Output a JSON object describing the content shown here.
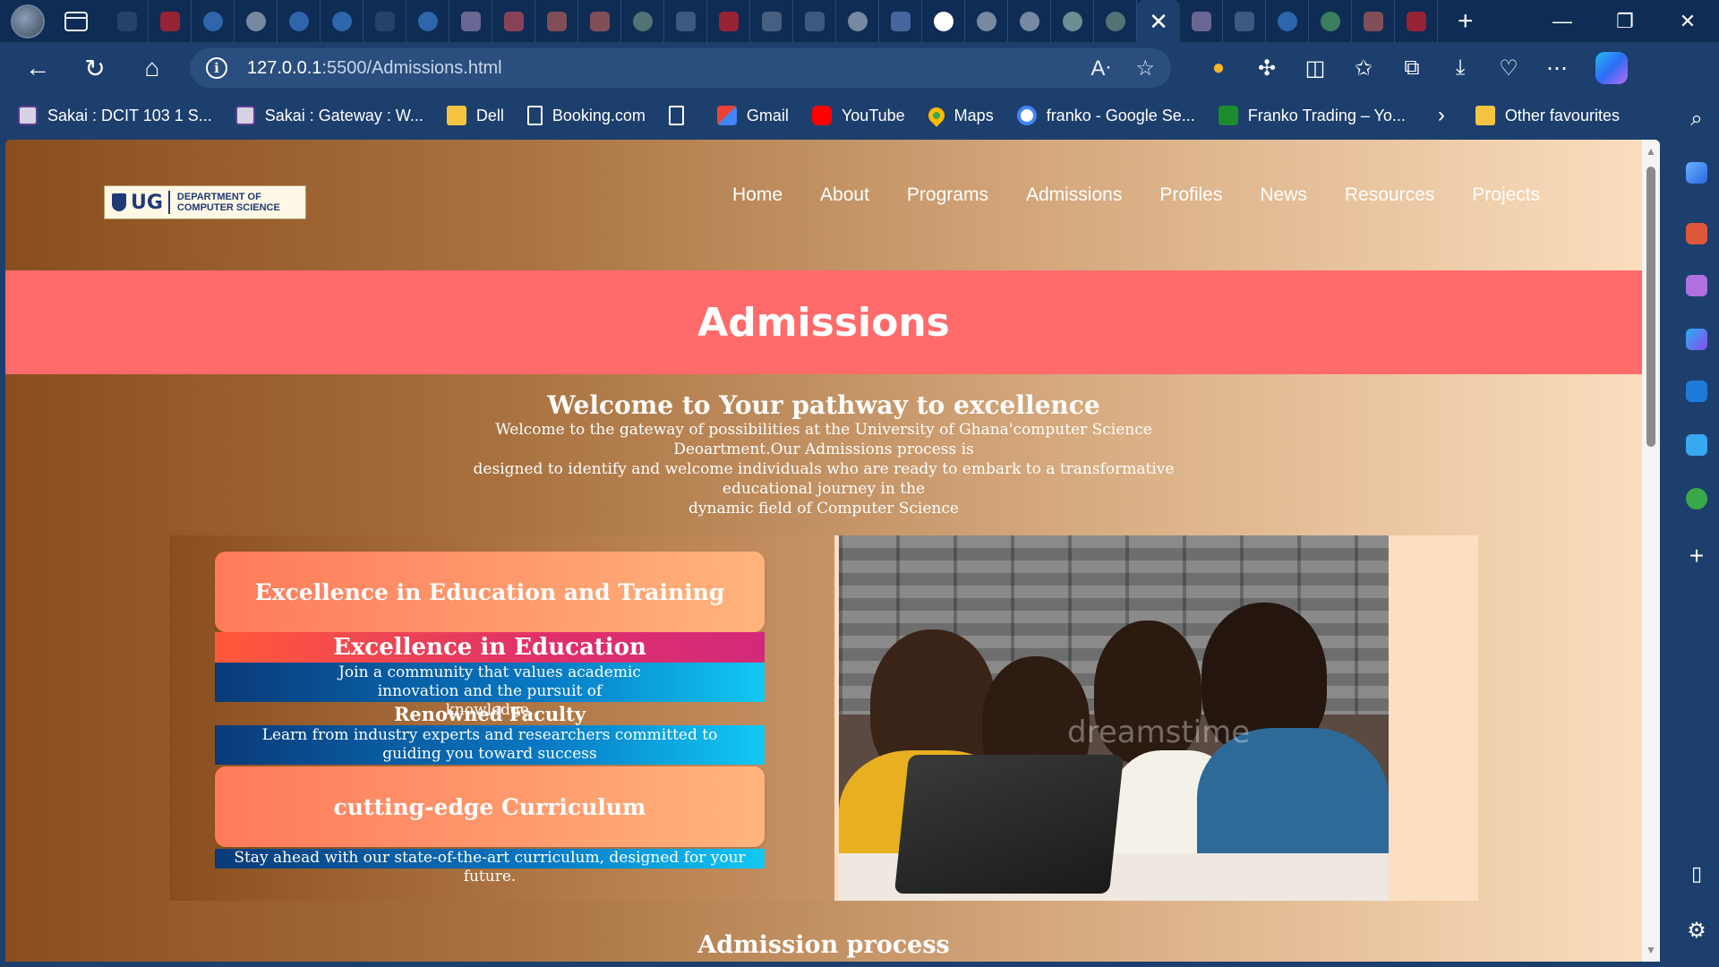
{
  "browser": {
    "address": {
      "host": "127.0.0.1",
      "rest": ":5500/Admissions.html"
    },
    "window_controls": {
      "minimize": "—",
      "maximize": "❐",
      "close": "✕"
    },
    "tab_close": "✕",
    "new_tab": "+",
    "favourites": [
      {
        "label": "Sakai : DCIT 103 1 S...",
        "icon": "sakai"
      },
      {
        "label": "Sakai : Gateway : W...",
        "icon": "sakai"
      },
      {
        "label": "Dell",
        "icon": "folder"
      },
      {
        "label": "Booking.com",
        "icon": "page"
      },
      {
        "label": "",
        "icon": "page"
      },
      {
        "label": "Gmail",
        "icon": "gmail"
      },
      {
        "label": "YouTube",
        "icon": "yt"
      },
      {
        "label": "Maps",
        "icon": "maps"
      },
      {
        "label": "franko - Google Se...",
        "icon": "google"
      },
      {
        "label": "Franko Trading – Yo...",
        "icon": "franko"
      }
    ],
    "favourites_more": "›",
    "other_favourites": "Other favourites"
  },
  "site": {
    "logo": {
      "mark": "UG",
      "text_line1": "DEPARTMENT OF",
      "text_line2": "COMPUTER SCIENCE"
    },
    "menu": [
      "Home",
      "About",
      "Programs",
      "Admissions",
      "Profiles",
      "News",
      "Resources",
      "Projects"
    ],
    "banner_title": "Admissions",
    "welcome_title": "Welcome to Your pathway to excellence",
    "welcome_lines": [
      "Welcome to the gateway of possibilities at the University of Ghana'computer Science Deoartment.Our Admissions process is",
      "designed to identify and welcome individuals who are ready to embark to a transformative educational journey in the",
      "dynamic field of Computer Science"
    ],
    "cards": {
      "card1": "Excellence in Education and Training",
      "stripe_title": "Excellence in Education",
      "stripe_text": "Join a community that values academic innovation and the pursuit of knowledge.",
      "faculty_title": "Renowned Faculty",
      "faculty_text": "Learn from industry experts and researchers committed to guiding you toward success",
      "card2": "cutting-edge Curriculum",
      "curriculum_text": "Stay ahead with our state-of-the-art curriculum, designed for your future."
    },
    "watermark": "dreamstime",
    "section_next": "Admission process"
  }
}
